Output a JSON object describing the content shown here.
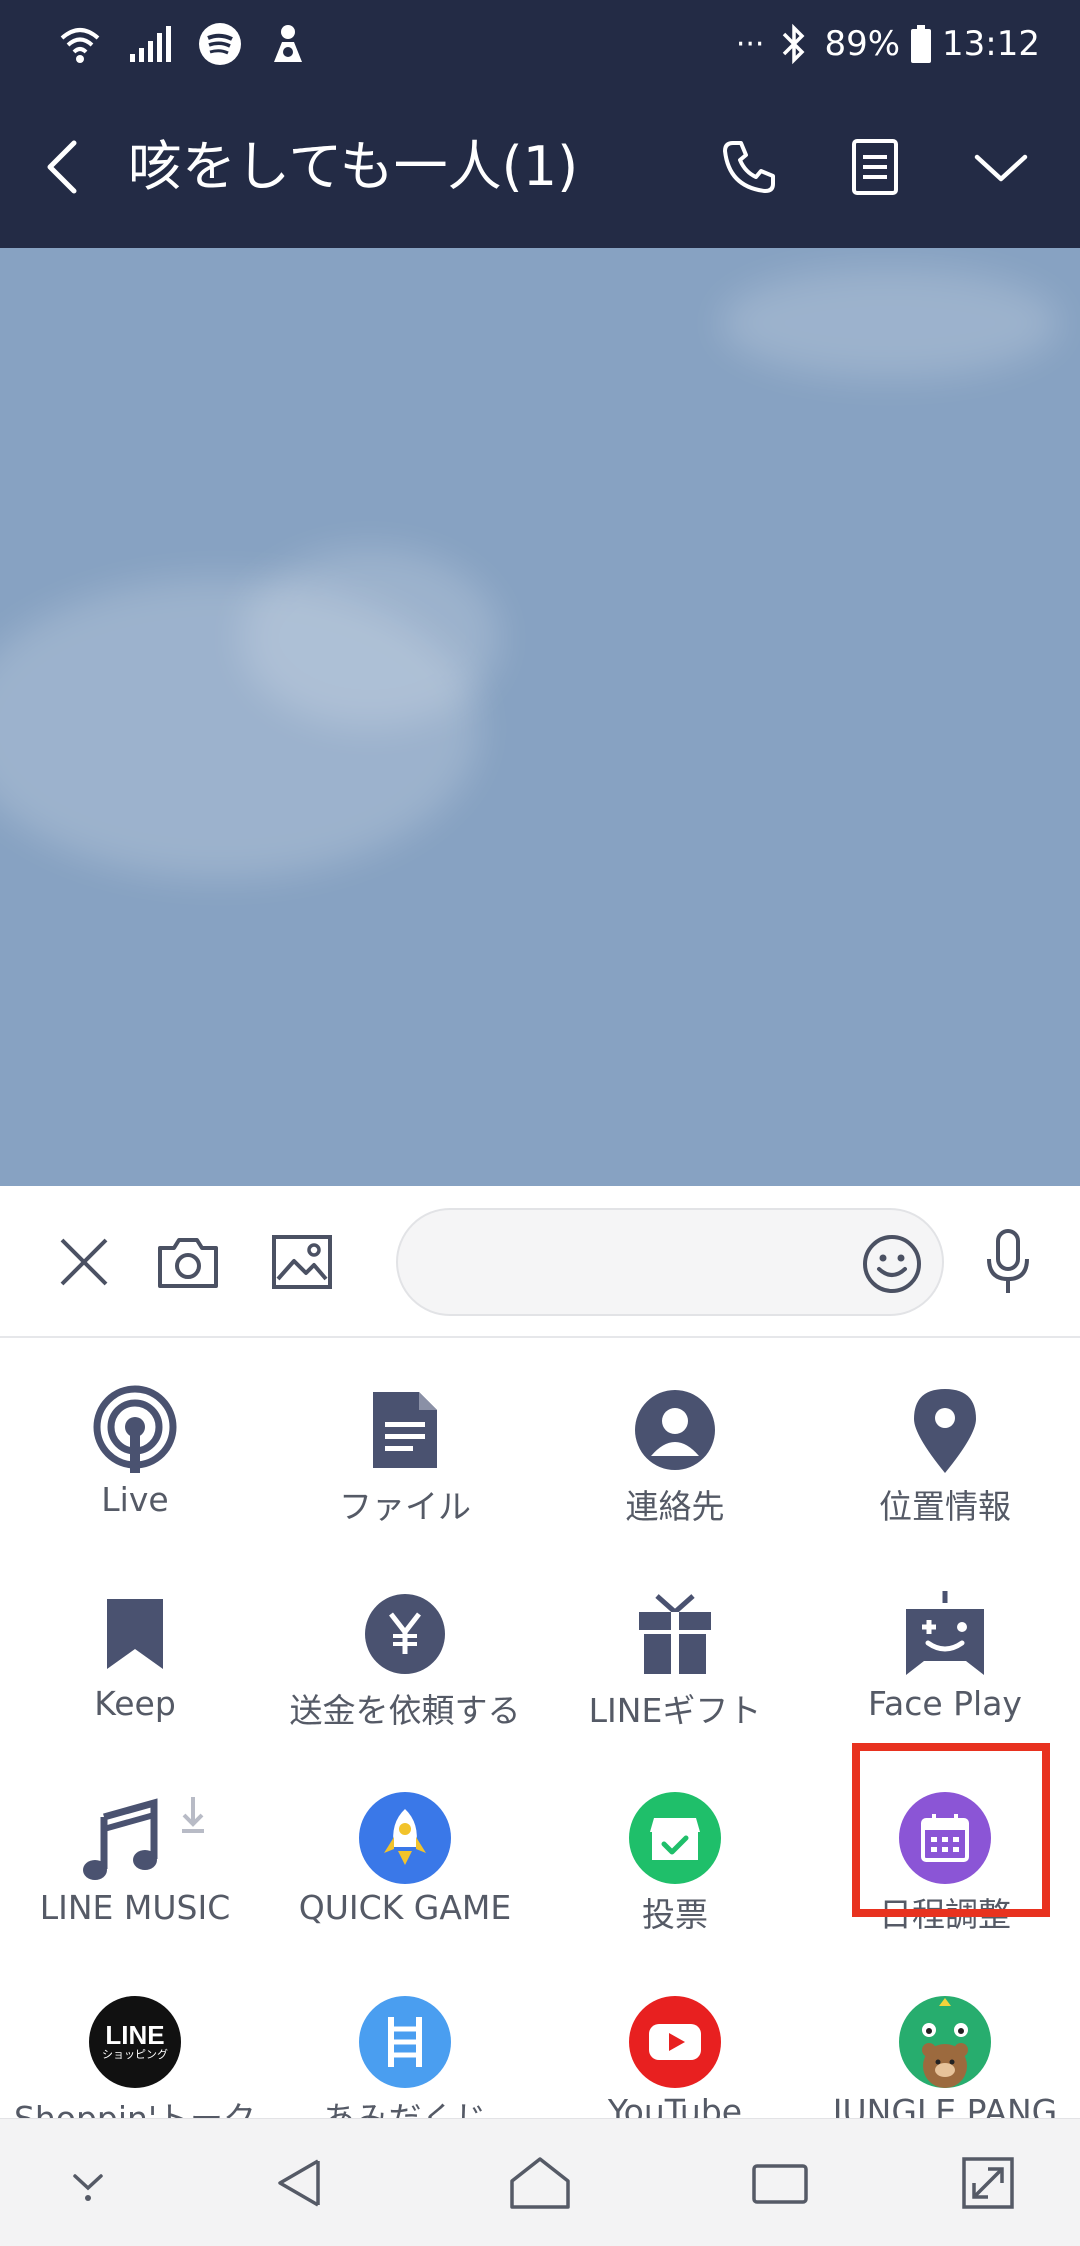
{
  "status_bar": {
    "battery": "89%",
    "time": "13:12",
    "dots": "···"
  },
  "header": {
    "title": "咳をしても一人(1)"
  },
  "input": {
    "placeholder": ""
  },
  "menu": {
    "items": [
      {
        "label": "Live",
        "icon": "live-icon"
      },
      {
        "label": "ファイル",
        "icon": "file-icon"
      },
      {
        "label": "連絡先",
        "icon": "contact-icon"
      },
      {
        "label": "位置情報",
        "icon": "location-icon"
      },
      {
        "label": "Keep",
        "icon": "bookmark-icon"
      },
      {
        "label": "送金を依頼する",
        "icon": "yen-icon"
      },
      {
        "label": "LINEギフト",
        "icon": "gift-icon"
      },
      {
        "label": "Face Play",
        "icon": "faceplay-icon"
      },
      {
        "label": "LINE MUSIC",
        "icon": "music-icon"
      },
      {
        "label": "QUICK GAME",
        "icon": "rocket-icon"
      },
      {
        "label": "投票",
        "icon": "vote-icon"
      },
      {
        "label": "日程調整",
        "icon": "calendar-icon"
      },
      {
        "label": "Shoppin'トーク",
        "icon": "line-shopping-icon"
      },
      {
        "label": "あみだくじ",
        "icon": "ladder-icon"
      },
      {
        "label": "YouTube",
        "icon": "youtube-icon"
      },
      {
        "label": "JUNGLE PANG",
        "icon": "jungle-pang-icon"
      }
    ],
    "line_logo_text": "LINE",
    "line_logo_sub": "ショッピング"
  },
  "colors": {
    "header_bg": "#232b45",
    "chat_bg": "#87a2c2",
    "icon_navy": "#4a5270",
    "highlight": "#e8321f",
    "quick_game_blue": "#3a78e8",
    "vote_green": "#1fbf6a",
    "calendar_purple": "#8b55d6",
    "ladder_blue": "#4a9ef0",
    "youtube_red": "#e82020",
    "jungle_green": "#27ad6e"
  }
}
